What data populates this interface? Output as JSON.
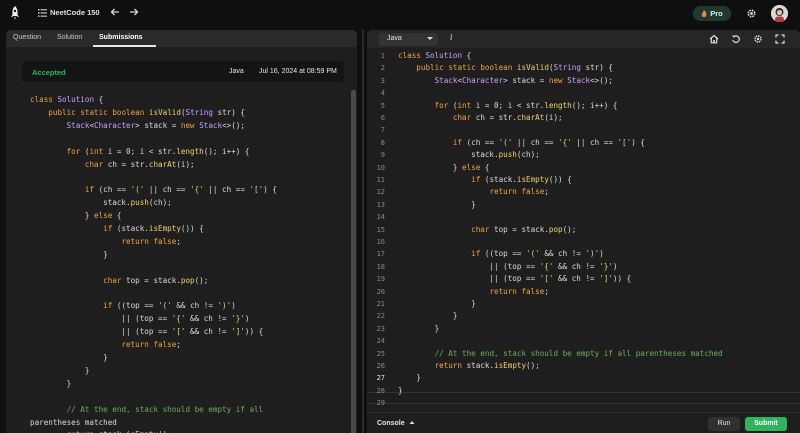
{
  "topbar": {
    "app_title": "NeetCode 150",
    "pro_label": "Pro"
  },
  "left": {
    "tabs": [
      "Question",
      "Solution",
      "Submissions"
    ],
    "active_tab": "Submissions",
    "result": {
      "status": "Accepted",
      "language": "Java",
      "date": "Jul 16, 2024 at 08:59 PM"
    },
    "code_lines": [
      "class Solution {",
      "    public static boolean isValid(String str) {",
      "        Stack<Character> stack = new Stack<>();",
      "",
      "        for (int i = 0; i < str.length(); i++) {",
      "            char ch = str.charAt(i);",
      "",
      "            if (ch == '(' || ch == '{' || ch == '[') {",
      "                stack.push(ch);",
      "            } else {",
      "                if (stack.isEmpty()) {",
      "                    return false;",
      "                }",
      "",
      "                char top = stack.pop();",
      "",
      "                if ((top == '(' && ch != ')')",
      "                    || (top == '{' && ch != '}')",
      "                    || (top == '[' && ch != ']')) {",
      "                    return false;",
      "                }",
      "            }",
      "        }",
      "",
      "        // At the end, stack should be empty if all",
      "parentheses matched",
      "        return stack.isEmpty();",
      "    }"
    ]
  },
  "right": {
    "language": "Java",
    "line_numbers": [
      "1",
      "2",
      "3",
      "4",
      "5",
      "6",
      "7",
      "8",
      "9",
      "10",
      "11",
      "12",
      "13",
      "14",
      "15",
      "16",
      "17",
      "18",
      "19",
      "20",
      "21",
      "22",
      "23",
      "24",
      "25",
      "26",
      "27",
      "28",
      "29"
    ],
    "current_line": 27,
    "code_lines": [
      "class Solution {",
      "    public static boolean isValid(String str) {",
      "        Stack<Character> stack = new Stack<>();",
      "",
      "        for (int i = 0; i < str.length(); i++) {",
      "            char ch = str.charAt(i);",
      "",
      "            if (ch == '(' || ch == '{' || ch == '[') {",
      "                stack.push(ch);",
      "            } else {",
      "                if (stack.isEmpty()) {",
      "                    return false;",
      "                }",
      "",
      "                char top = stack.pop();",
      "",
      "                if ((top == '(' && ch != ')')",
      "                    || (top == '{' && ch != '}')",
      "                    || (top == '[' && ch != ']')) {",
      "                    return false;",
      "                }",
      "            }",
      "        }",
      "",
      "        // At the end, stack should be empty if all parentheses matched",
      "        return stack.isEmpty();",
      "    }",
      "}",
      ""
    ],
    "console_label": "Console",
    "run_label": "Run",
    "submit_label": "Submit"
  },
  "colors": {
    "accent_green": "#2db55d",
    "keyword": "#f1a43a",
    "comment": "#6fae5b"
  }
}
